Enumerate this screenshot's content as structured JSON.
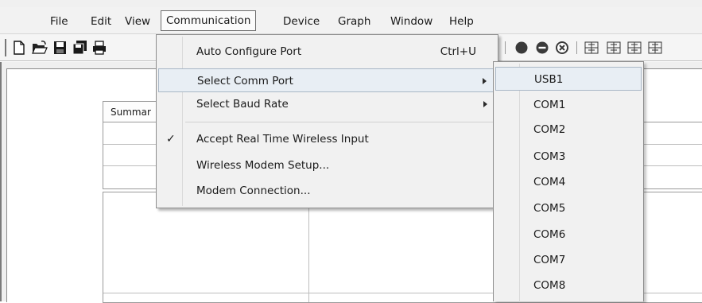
{
  "menubar": {
    "items": [
      {
        "label": "File"
      },
      {
        "label": "Edit"
      },
      {
        "label": "View"
      },
      {
        "label": "Communication"
      },
      {
        "label": "Device"
      },
      {
        "label": "Graph"
      },
      {
        "label": "Window"
      },
      {
        "label": "Help"
      }
    ]
  },
  "toolbar": {
    "icons": [
      "new-file-icon",
      "open-folder-icon",
      "save-icon",
      "save-all-icon",
      "print-icon",
      "record-icon",
      "minus-icon",
      "stop-icon",
      "ah-icon",
      "ph-icon",
      "sh-icon",
      "grid-icon"
    ]
  },
  "document": {
    "tab_label": "Summar"
  },
  "communication_menu": {
    "items": [
      {
        "label": "Auto Configure Port",
        "shortcut": "Ctrl+U"
      },
      {
        "label": "Select Comm Port",
        "has_submenu": true,
        "highlighted": true
      },
      {
        "label": "Select Baud Rate",
        "has_submenu": true
      },
      {
        "label": "Accept Real Time Wireless Input",
        "checked": true,
        "check_mark": "✓"
      },
      {
        "label": "Wireless Modem Setup..."
      },
      {
        "label": "Modem Connection..."
      }
    ]
  },
  "comm_port_submenu": {
    "items": [
      {
        "label": "USB1",
        "highlighted": true
      },
      {
        "label": "COM1"
      },
      {
        "label": "COM2"
      },
      {
        "label": "COM3"
      },
      {
        "label": "COM4"
      },
      {
        "label": "COM5"
      },
      {
        "label": "COM6"
      },
      {
        "label": "COM7"
      },
      {
        "label": "COM8"
      }
    ]
  }
}
